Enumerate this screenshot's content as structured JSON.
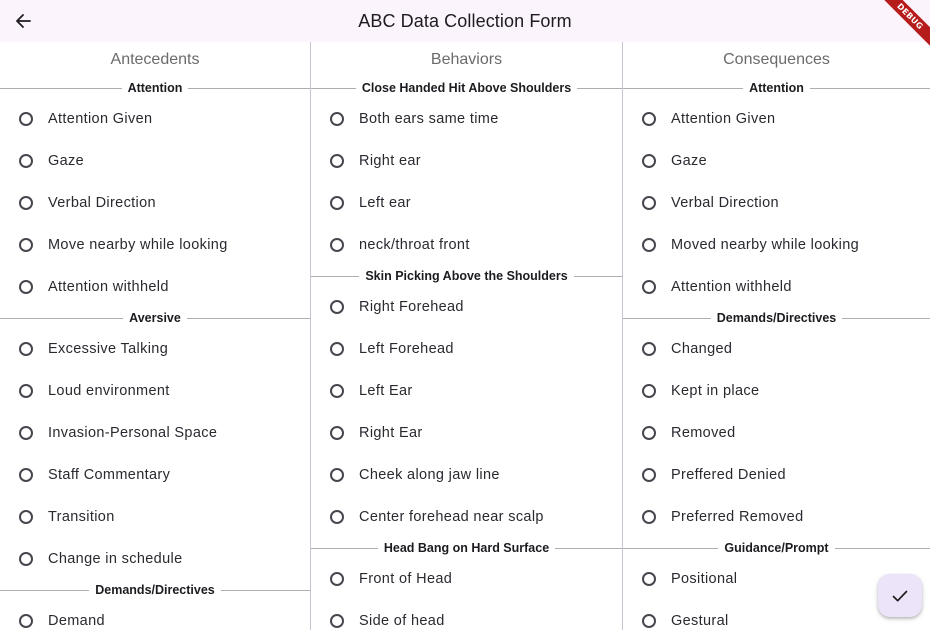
{
  "app": {
    "title": "ABC Data Collection Form",
    "debug_label": "DEBUG"
  },
  "columns": [
    {
      "header": "Antecedents",
      "sections": [
        {
          "title": "Attention",
          "options": [
            "Attention Given",
            "Gaze",
            "Verbal Direction",
            "Move nearby while looking",
            "Attention withheld"
          ]
        },
        {
          "title": "Aversive",
          "options": [
            "Excessive Talking",
            "Loud environment",
            "Invasion-Personal Space",
            "Staff Commentary",
            "Transition",
            "Change in schedule"
          ]
        },
        {
          "title": "Demands/Directives",
          "options": [
            "Demand"
          ]
        }
      ]
    },
    {
      "header": "Behaviors",
      "sections": [
        {
          "title": "Close Handed Hit Above Shoulders",
          "options": [
            "Both ears same time",
            "Right ear",
            "Left ear",
            "neck/throat front"
          ]
        },
        {
          "title": "Skin Picking Above the Shoulders",
          "options": [
            "Right Forehead",
            "Left Forehead",
            "Left Ear",
            "Right Ear",
            "Cheek along jaw line",
            "Center forehead near scalp"
          ]
        },
        {
          "title": "Head Bang on Hard Surface",
          "options": [
            "Front of Head",
            "Side of head"
          ]
        }
      ]
    },
    {
      "header": "Consequences",
      "sections": [
        {
          "title": "Attention",
          "options": [
            "Attention Given",
            "Gaze",
            "Verbal Direction",
            "Moved nearby while looking",
            "Attention withheld"
          ]
        },
        {
          "title": "Demands/Directives",
          "options": [
            "Changed",
            "Kept in place",
            "Removed",
            "Preffered Denied",
            "Preferred Removed"
          ]
        },
        {
          "title": "Guidance/Prompt",
          "options": [
            "Positional",
            "Gestural"
          ]
        }
      ]
    }
  ],
  "icons": {
    "back": "arrow-back-icon",
    "submit": "check-icon"
  },
  "colors": {
    "appbar": "#fcf4fc",
    "fab": "#ece4f8",
    "debug": "#b71c1c",
    "accent": "#6750a4"
  }
}
